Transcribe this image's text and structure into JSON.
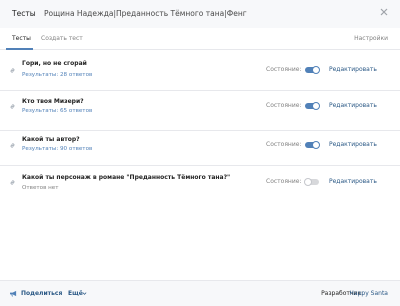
{
  "header": {
    "app_name": "Тесты",
    "subtitle": "Рощина Надежда|Преданность Тёмного тана|Фенг",
    "close_icon": "close-icon"
  },
  "tabs": [
    {
      "label": "Тесты",
      "active": true
    },
    {
      "label": "Создать тест",
      "active": false
    }
  ],
  "settings_label": "Настройки",
  "tests": [
    {
      "title": "Гори, но не сгорай",
      "results": "Результаты: 28 ответов",
      "state_label": "Состояние:",
      "enabled": true,
      "edit_label": "Редактировать"
    },
    {
      "title": "Кто твоя Мизери?",
      "results": "Результаты: 65 ответов",
      "state_label": "Состояние:",
      "enabled": true,
      "edit_label": "Редактировать"
    },
    {
      "title": "Какой ты автор?",
      "results": "Результаты: 90 ответов",
      "state_label": "Состояние:",
      "enabled": true,
      "edit_label": "Редактировать"
    },
    {
      "title": "Какой ты персонаж в романе \"Преданность Тёмного тана?\"",
      "results": "Ответов нет",
      "state_label": "Состояние:",
      "enabled": false,
      "edit_label": "Редактировать"
    }
  ],
  "footer": {
    "share_label": "Поделиться",
    "more_label": "Ещё",
    "developer_label": "Разработчик:",
    "developer_name": "Happy Santa"
  },
  "colors": {
    "accent": "#5181b8",
    "link": "#2a5885",
    "muted": "#828282"
  }
}
